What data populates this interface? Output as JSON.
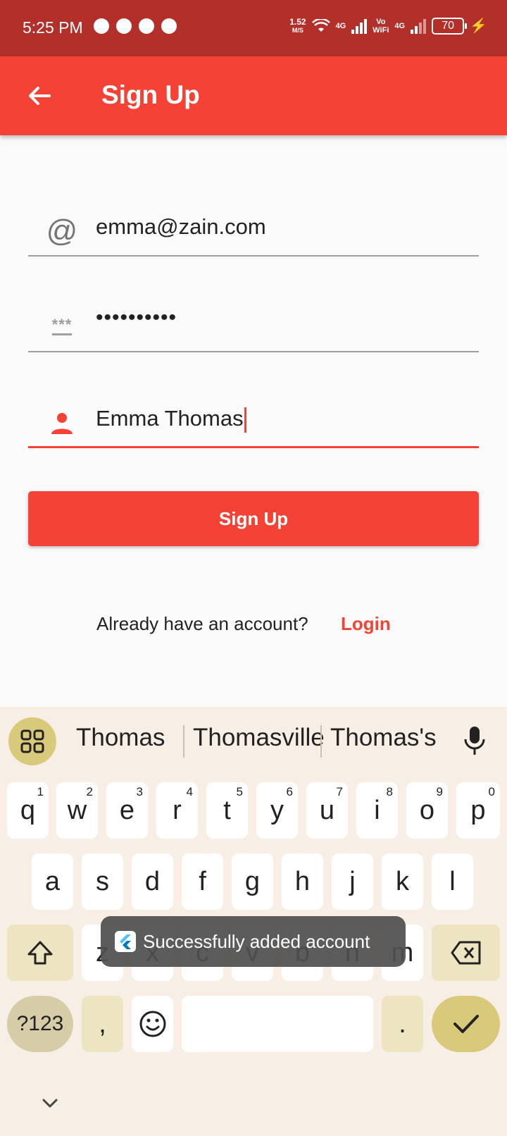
{
  "status_bar": {
    "time": "5:25 PM",
    "speed_value": "1.52",
    "speed_unit": "M/S",
    "net1": "4G",
    "vowifi_top": "Vo",
    "vowifi_bottom": "WiFi",
    "net2": "4G",
    "battery": "70"
  },
  "app_bar": {
    "title": "Sign Up"
  },
  "form": {
    "email_value": "emma@zain.com",
    "email_icon": "@",
    "password_icon_text": "***",
    "password_value": "••••••••••",
    "name_value": "Emma Thomas"
  },
  "signup_button": {
    "label": "Sign Up"
  },
  "login_prompt": {
    "text": "Already have an account?",
    "link": "Login"
  },
  "keyboard": {
    "suggestions": [
      "Thomas",
      "Thomasville",
      "Thomas's"
    ],
    "row1": [
      {
        "key": "q",
        "hint": "1"
      },
      {
        "key": "w",
        "hint": "2"
      },
      {
        "key": "e",
        "hint": "3"
      },
      {
        "key": "r",
        "hint": "4"
      },
      {
        "key": "t",
        "hint": "5"
      },
      {
        "key": "y",
        "hint": "6"
      },
      {
        "key": "u",
        "hint": "7"
      },
      {
        "key": "i",
        "hint": "8"
      },
      {
        "key": "o",
        "hint": "9"
      },
      {
        "key": "p",
        "hint": "0"
      }
    ],
    "row2": [
      "a",
      "s",
      "d",
      "f",
      "g",
      "h",
      "j",
      "k",
      "l"
    ],
    "row3": [
      "z",
      "x",
      "c",
      "v",
      "b",
      "n",
      "m"
    ],
    "symbols_label": "?123",
    "comma_label": ",",
    "period_label": "."
  },
  "toast": {
    "message": "Successfully added account"
  },
  "colors": {
    "primary": "#f44336",
    "status_bar": "#b3302a",
    "keyboard_bg": "#f7efe5",
    "keyboard_accent": "#d9c97a"
  }
}
